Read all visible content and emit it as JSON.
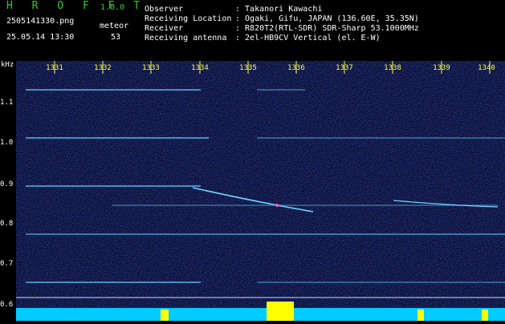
{
  "header": {
    "app_name": "H R O F F T",
    "version": "1.0.0",
    "filename": "2505141330.png",
    "event_label": "meteor",
    "datetime": "25.05.14 13:30",
    "event_count": "53",
    "info_labels": [
      "Observer",
      "Receiving Location",
      "Receiver",
      "Receiving antenna"
    ],
    "info_values": [
      ": Takanori Kawachi",
      ": Ogaki, Gifu, JAPAN (136.60E, 35.35N)",
      ": R820T2(RTL-SDR) SDR-Sharp 53.1000MHz",
      ": 2el-HB9CV Vertical (el. E-W)"
    ]
  },
  "axis": {
    "y_unit": "kHz",
    "y_ticks": [
      "1.1",
      "1.0",
      "0.9",
      "0.8",
      "0.7",
      "0.6"
    ],
    "x_ticks": [
      "1331",
      "1332",
      "1333",
      "1334",
      "1335",
      "1336",
      "1337",
      "1338",
      "1339",
      "1340"
    ]
  },
  "colors": {
    "background": "#000000",
    "spectrum_bg": "#0a0a2e",
    "trace": "#4fb7e6",
    "title_green": "#33cc33",
    "tick_yellow": "#ffff44",
    "level_cyan": "#00ccff",
    "level_yellow": "#ffff00"
  }
}
